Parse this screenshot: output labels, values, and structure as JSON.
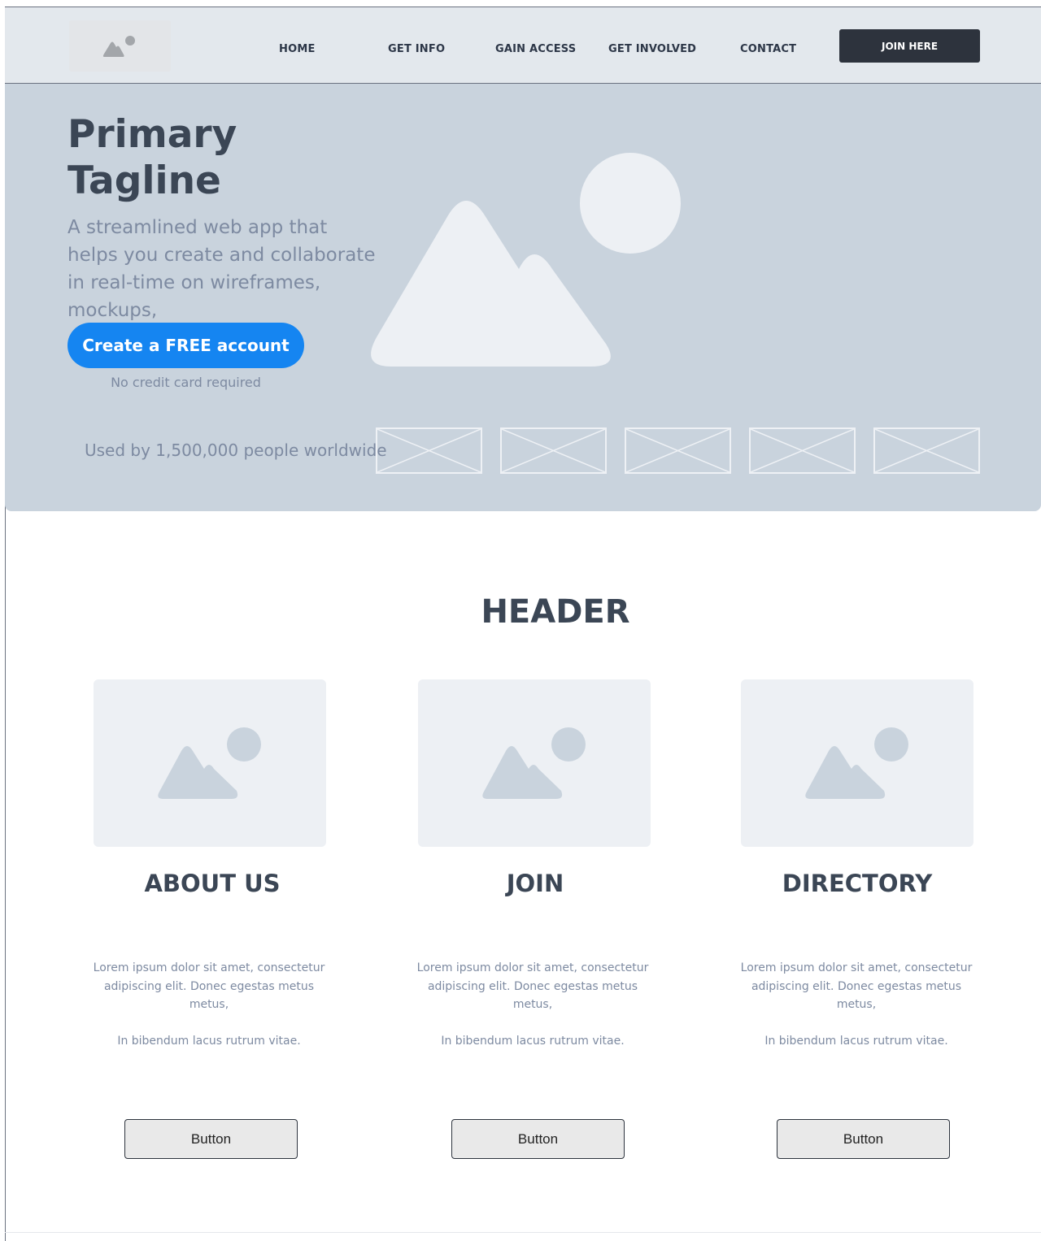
{
  "nav": {
    "logo_icon": "image-placeholder-icon",
    "links": [
      "HOME",
      "GET INFO",
      "GAIN ACCESS",
      "GET INVOLVED",
      "CONTACT"
    ],
    "join_label": "JOIN HERE"
  },
  "hero": {
    "title_line1": "Primary",
    "title_line2": "Tagline",
    "subtitle": "A streamlined web app that helps you create and collaborate in real-time on wireframes, mockups,",
    "cta_label": "Create a FREE account",
    "cta_note": "No credit card required",
    "used_by": "Used by 1,500,000 people worldwide",
    "image_icon": "mountain-sun-image-icon"
  },
  "section": {
    "header": "HEADER",
    "cards": [
      {
        "title": "ABOUT US",
        "text1": "Lorem ipsum dolor sit amet, consectetur adipiscing elit. Donec egestas metus metus,",
        "text2": "In bibendum lacus rutrum vitae.",
        "button": "Button"
      },
      {
        "title": "JOIN",
        "text1": "Lorem ipsum dolor sit amet, consectetur adipiscing elit. Donec egestas metus metus,",
        "text2": "In bibendum lacus rutrum vitae.",
        "button": "Button"
      },
      {
        "title": "DIRECTORY",
        "text1": "Lorem ipsum dolor sit amet, consectetur adipiscing elit. Donec egestas metus metus,",
        "text2": "In bibendum lacus rutrum vitae.",
        "button": "Button"
      }
    ]
  },
  "colors": {
    "nav_bg": "#e3e8ed",
    "hero_bg": "#c9d3dd",
    "cta": "#1585f1",
    "join_button": "#2d333d",
    "heading": "#3b4655",
    "muted_text": "#7d8aa1"
  }
}
